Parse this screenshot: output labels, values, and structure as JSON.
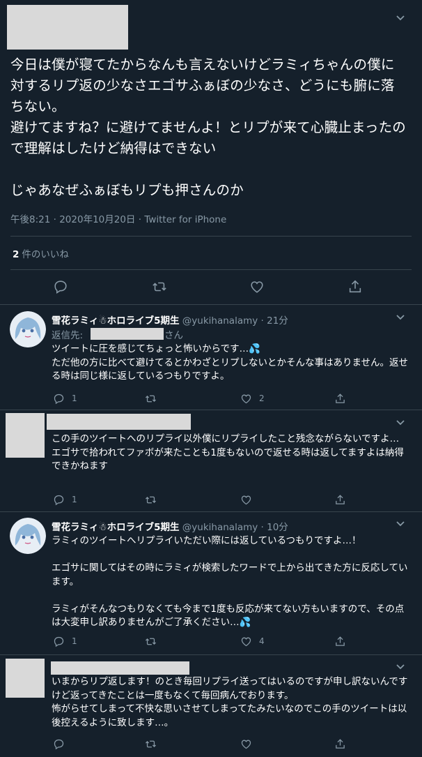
{
  "main_tweet": {
    "text": "今日は僕が寝てたからなんも言えないけどラミィちゃんの僕に対するリプ返の少なさエゴサふぁぼの少なさ、どうにも腑に落ちない。\n避けてますね？に避けてませんよ！とリプが来て心臓止まったので理解はしたけど納得はできない\n\nじゃあなぜふぁぼもリプも押さんのか",
    "time": "午後8:21",
    "date": "2020年10月20日",
    "source": "Twitter for iPhone",
    "likes_count": "2",
    "likes_label": "件のいいね"
  },
  "replies": [
    {
      "name": "雪花ラミィ☃ホロライブ5期生",
      "handle": "@yukihanalamy",
      "time": "21分",
      "reply_to_label": "返信先:",
      "reply_to_suffix": "さん",
      "text": "ツイートに圧を感じてちょっと怖いからです…💦\nただ他の方に比べて避けてるとかわざとリプしないとかそんな事はありません。返せる時は同じ様に返しているつもりですよ。",
      "reply_count": "1",
      "retweet_count": "",
      "like_count": "2"
    },
    {
      "text": "この手のツイートへのリプライ以外僕にリプライしたこと残念ながらないですよ…\nエゴサで拾われてファボが来たことも1度もないので返せる時は返してますよは納得できかねます",
      "reply_count": "1",
      "retweet_count": "",
      "like_count": ""
    },
    {
      "name": "雪花ラミィ☃ホロライブ5期生",
      "handle": "@yukihanalamy",
      "time": "10分",
      "text": "ラミィのツイートへリプライいただい際には返しているつもりですよ…！\n\nエゴサに関してはその時にラミィが検索したワードで上から出てきた方に反応しています。\n\nラミィがそんなつもりなくても今まで1度も反応が来てない方もいますので、その点は大変申し訳ありませんがご了承ください…💦",
      "reply_count": "1",
      "retweet_count": "",
      "like_count": "4"
    },
    {
      "text": "いまからリプ返します！のとき毎回リプライ送ってはいるのですが申し訳ないんですけど返ってきたことは一度もなくて毎回病んでおります。\n怖がらせてしまって不快な思いさせてしまってたみたいなのでこの手のツイートは以後控えるように致します…。",
      "reply_count": "",
      "retweet_count": "",
      "like_count": ""
    }
  ],
  "colors": {
    "background": "#15202b",
    "divider": "#38444d",
    "muted": "#8899a6",
    "text": "#ffffff"
  }
}
